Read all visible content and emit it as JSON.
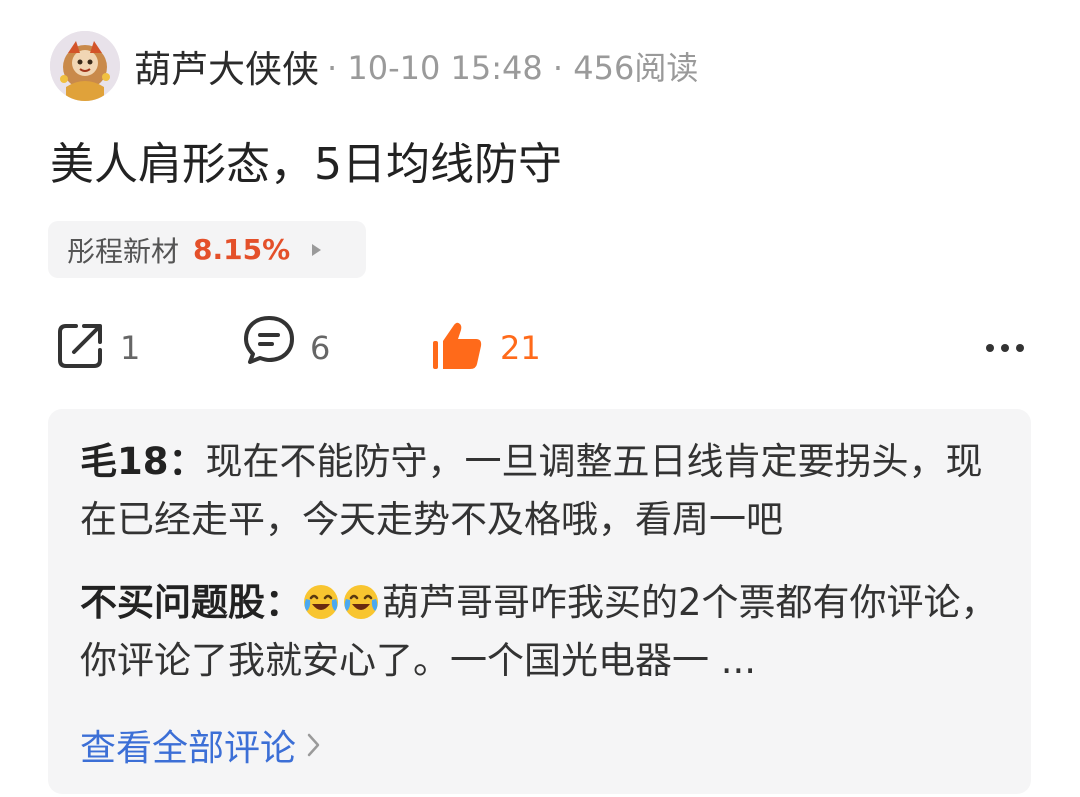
{
  "post": {
    "author": "葫芦大侠侠",
    "meta": "· 10-10 15:48 · 456阅读",
    "title": "美人肩形态，5日均线防守"
  },
  "stock": {
    "name": "彤程新材",
    "change": "8.15%",
    "change_color": "#e4502a"
  },
  "actions": {
    "share_count": "1",
    "comment_count": "6",
    "like_count": "21",
    "share_icon": "share-icon",
    "comment_icon": "comment-icon",
    "like_icon": "thumbs-up-icon",
    "more_icon": "more-icon",
    "like_color": "#ff6a1a"
  },
  "comments": {
    "items": [
      {
        "author": "毛18：",
        "text": "现在不能防守，一旦调整五日线肯定要拐头，现在已经走平，今天走势不及格哦，看周一吧"
      },
      {
        "author": "不买问题股：",
        "text": "葫芦哥哥咋我买的2个票都有你评论，你评论了我就安心了。一个国光电器一 ..."
      }
    ],
    "view_all": "查看全部评论",
    "link_color": "#3c6fd6"
  }
}
